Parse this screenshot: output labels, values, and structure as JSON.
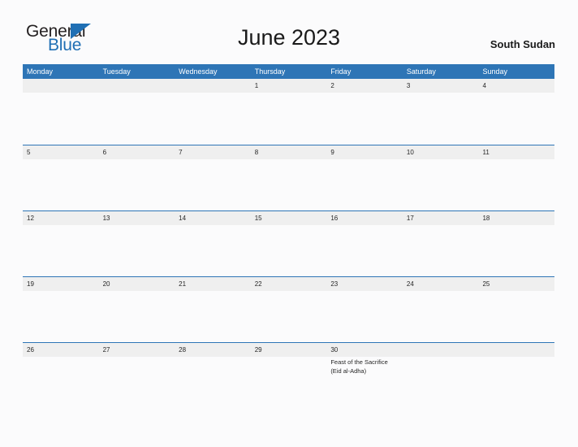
{
  "brand": {
    "name_part1": "General",
    "name_part2": "Blue",
    "flag_icon": "triangle-flag-icon",
    "primary_color": "#1f6fb4"
  },
  "header": {
    "title": "June 2023",
    "location": "South Sudan"
  },
  "theme": {
    "header_blue": "#2e75b6",
    "day_band_gray": "#efefef",
    "page_background": "#fbfbfc",
    "text_dark": "#262626"
  },
  "calendar": {
    "month": "June",
    "year": "2023",
    "weekday_headers": [
      "Monday",
      "Tuesday",
      "Wednesday",
      "Thursday",
      "Friday",
      "Saturday",
      "Sunday"
    ],
    "weeks": [
      {
        "days": [
          {
            "number": "",
            "events": []
          },
          {
            "number": "",
            "events": []
          },
          {
            "number": "",
            "events": []
          },
          {
            "number": "1",
            "events": []
          },
          {
            "number": "2",
            "events": []
          },
          {
            "number": "3",
            "events": []
          },
          {
            "number": "4",
            "events": []
          }
        ]
      },
      {
        "days": [
          {
            "number": "5",
            "events": []
          },
          {
            "number": "6",
            "events": []
          },
          {
            "number": "7",
            "events": []
          },
          {
            "number": "8",
            "events": []
          },
          {
            "number": "9",
            "events": []
          },
          {
            "number": "10",
            "events": []
          },
          {
            "number": "11",
            "events": []
          }
        ]
      },
      {
        "days": [
          {
            "number": "12",
            "events": []
          },
          {
            "number": "13",
            "events": []
          },
          {
            "number": "14",
            "events": []
          },
          {
            "number": "15",
            "events": []
          },
          {
            "number": "16",
            "events": []
          },
          {
            "number": "17",
            "events": []
          },
          {
            "number": "18",
            "events": []
          }
        ]
      },
      {
        "days": [
          {
            "number": "19",
            "events": []
          },
          {
            "number": "20",
            "events": []
          },
          {
            "number": "21",
            "events": []
          },
          {
            "number": "22",
            "events": []
          },
          {
            "number": "23",
            "events": []
          },
          {
            "number": "24",
            "events": []
          },
          {
            "number": "25",
            "events": []
          }
        ]
      },
      {
        "days": [
          {
            "number": "26",
            "events": []
          },
          {
            "number": "27",
            "events": []
          },
          {
            "number": "28",
            "events": []
          },
          {
            "number": "29",
            "events": []
          },
          {
            "number": "30",
            "events": [
              "Feast of the Sacrifice (Eid al-Adha)"
            ]
          },
          {
            "number": "",
            "events": []
          },
          {
            "number": "",
            "events": []
          }
        ]
      }
    ]
  }
}
